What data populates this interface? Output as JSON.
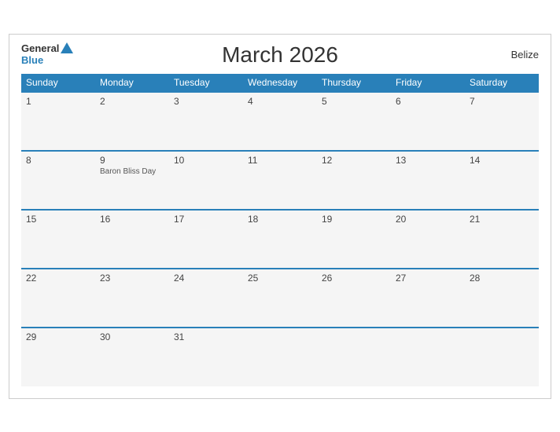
{
  "header": {
    "title": "March 2026",
    "country": "Belize",
    "logo_general": "General",
    "logo_blue": "Blue"
  },
  "weekdays": [
    "Sunday",
    "Monday",
    "Tuesday",
    "Wednesday",
    "Thursday",
    "Friday",
    "Saturday"
  ],
  "weeks": [
    [
      {
        "day": "1",
        "event": ""
      },
      {
        "day": "2",
        "event": ""
      },
      {
        "day": "3",
        "event": ""
      },
      {
        "day": "4",
        "event": ""
      },
      {
        "day": "5",
        "event": ""
      },
      {
        "day": "6",
        "event": ""
      },
      {
        "day": "7",
        "event": ""
      }
    ],
    [
      {
        "day": "8",
        "event": ""
      },
      {
        "day": "9",
        "event": "Baron Bliss Day"
      },
      {
        "day": "10",
        "event": ""
      },
      {
        "day": "11",
        "event": ""
      },
      {
        "day": "12",
        "event": ""
      },
      {
        "day": "13",
        "event": ""
      },
      {
        "day": "14",
        "event": ""
      }
    ],
    [
      {
        "day": "15",
        "event": ""
      },
      {
        "day": "16",
        "event": ""
      },
      {
        "day": "17",
        "event": ""
      },
      {
        "day": "18",
        "event": ""
      },
      {
        "day": "19",
        "event": ""
      },
      {
        "day": "20",
        "event": ""
      },
      {
        "day": "21",
        "event": ""
      }
    ],
    [
      {
        "day": "22",
        "event": ""
      },
      {
        "day": "23",
        "event": ""
      },
      {
        "day": "24",
        "event": ""
      },
      {
        "day": "25",
        "event": ""
      },
      {
        "day": "26",
        "event": ""
      },
      {
        "day": "27",
        "event": ""
      },
      {
        "day": "28",
        "event": ""
      }
    ],
    [
      {
        "day": "29",
        "event": ""
      },
      {
        "day": "30",
        "event": ""
      },
      {
        "day": "31",
        "event": ""
      },
      {
        "day": "",
        "event": ""
      },
      {
        "day": "",
        "event": ""
      },
      {
        "day": "",
        "event": ""
      },
      {
        "day": "",
        "event": ""
      }
    ]
  ]
}
